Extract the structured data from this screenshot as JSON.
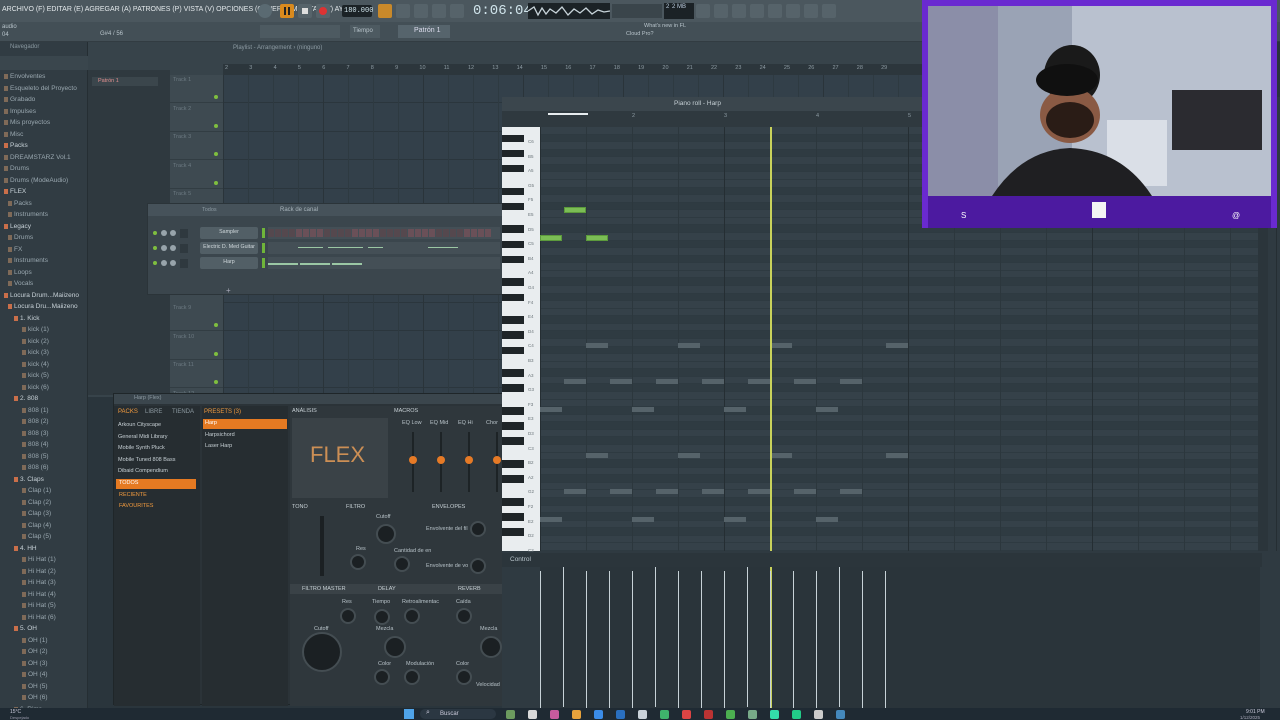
{
  "menu": {
    "text": "ARCHIVO (F) EDITAR (E) AGREGAR (A) PATRONES (P) VISTA (V) OPCIONES (O) HERRAMIENTAS (T) AYUDA"
  },
  "transport": {
    "tempo": "180.000",
    "time": "0:06:04",
    "cpu": "2",
    "memory": "2 MB",
    "hint_line1": "What's new in FL",
    "hint_line2": "Cloud Pro?",
    "pattern": "Patrón 1",
    "tempo_label": "Tiempo"
  },
  "header_left": {
    "project": "audio",
    "counter": "04",
    "ratio": "G#4 / 56"
  },
  "browser": {
    "title": "Navegador",
    "items": [
      "Envolventes",
      "Esqueleto del Proyecto",
      "Grabado",
      "Impulses",
      "Mis proyectos",
      "Misc",
      "Packs",
      "DREAMSTARZ Vol.1",
      "Drums",
      "Drums (ModeAudio)",
      "FLEX",
      "Packs",
      "Instruments",
      "Legacy",
      "Drums",
      "FX",
      "Instruments",
      "Loops",
      "Vocals",
      "Locura Drum...Maiizeno",
      "Locura Dru...Maiizeno",
      "1. Kick",
      "kick (1)",
      "kick (2)",
      "kick (3)",
      "kick (4)",
      "kick (5)",
      "kick (6)",
      "2. 808",
      "808 (1)",
      "808 (2)",
      "808 (3)",
      "808 (4)",
      "808 (5)",
      "808 (6)",
      "3. Claps",
      "Clap (1)",
      "Clap (2)",
      "Clap (3)",
      "Clap (4)",
      "Clap (5)",
      "4. HH",
      "Hi Hat (1)",
      "Hi Hat (2)",
      "Hi Hat (3)",
      "Hi Hat (4)",
      "Hi Hat (5)",
      "Hi Hat (6)",
      "5. OH",
      "OH (1)",
      "OH (2)",
      "OH (3)",
      "OH (4)",
      "OH (5)",
      "OH (6)",
      "6. Rims"
    ]
  },
  "playlist": {
    "title": "Playlist - Arrangement › (ninguno)",
    "pattern_item": "Patrón 1",
    "tracks": [
      "Track 1",
      "Track 2",
      "Track 3",
      "Track 4",
      "Track 5",
      "Track 9",
      "Track 10",
      "Track 11",
      "Track 12"
    ],
    "ruler": [
      "2",
      "3",
      "4",
      "5",
      "6",
      "7",
      "8",
      "9",
      "10",
      "11",
      "12",
      "13",
      "14",
      "15",
      "16",
      "17",
      "18",
      "19",
      "20",
      "21",
      "22",
      "23",
      "24",
      "25",
      "26",
      "27",
      "28",
      "29"
    ]
  },
  "rack": {
    "title": "Rack de canal",
    "filter": "Todos",
    "channels": [
      "Sampler",
      "Electric D. Med Guitar",
      "Harp"
    ]
  },
  "flex": {
    "title": "Harp (Flex)",
    "tabs": [
      "PACKS",
      "LIBRE",
      "TIENDA"
    ],
    "presets_tab": "PRESETS (3)",
    "packs": [
      "Arkoun Cityscape",
      "General Midi Library",
      "Mobile Synth Pluck",
      "Mobile Tuned 808 Bass",
      "Dibaid Compendium"
    ],
    "packs_special": [
      "TODOS",
      "RECIENTE",
      "FAVOURITES"
    ],
    "presets": [
      "Harp",
      "Harpsichord",
      "Laser Harp"
    ],
    "logo": "FLEX",
    "sections": {
      "analysis": "ANÁLISIS",
      "macros": "MACROS",
      "eq": [
        "EQ Low",
        "EQ Mid",
        "EQ Hi",
        "Chor"
      ],
      "tone": "TONO",
      "filter": "FILTRO",
      "envelopes": "ENVELOPES",
      "cutoff": "Cutoff",
      "res": "Res",
      "env_filter": "Envolvente del fil",
      "env_vol": "Envolvente de vo",
      "amount": "Cantidad de en",
      "master_filter": "FILTRO MASTER",
      "delay": "DELAY",
      "reverb": "REVERB",
      "delay_labels": [
        "Tiempo",
        "Retroalimentac",
        "Mezcla",
        "Modulación",
        "Color"
      ],
      "reverb_labels": [
        "Caída",
        "Mezcla",
        "Color",
        "Velocidad"
      ],
      "master_labels": [
        "Res",
        "Cutoff"
      ]
    }
  },
  "pianoroll": {
    "title": "Piano roll - Harp",
    "control_label": "Control",
    "ruler": [
      "2",
      "3",
      "4",
      "5"
    ],
    "keys": [
      "C6",
      "B5",
      "A5",
      "G5",
      "F5",
      "E5",
      "D5",
      "C5",
      "B4",
      "A4",
      "G4",
      "F4",
      "E4",
      "D4",
      "C4",
      "B3",
      "A3",
      "G3",
      "F3",
      "E3",
      "D3",
      "C3",
      "B2",
      "A2",
      "G2",
      "F2",
      "E2",
      "D2",
      "C2"
    ]
  },
  "webcam": {
    "left_badge": "S",
    "right_badge": "@"
  },
  "taskbar": {
    "temp": "15°C",
    "weather": "Despejado",
    "search": "Buscar",
    "clock": "9:01 PM",
    "date": "1/12/2025"
  }
}
